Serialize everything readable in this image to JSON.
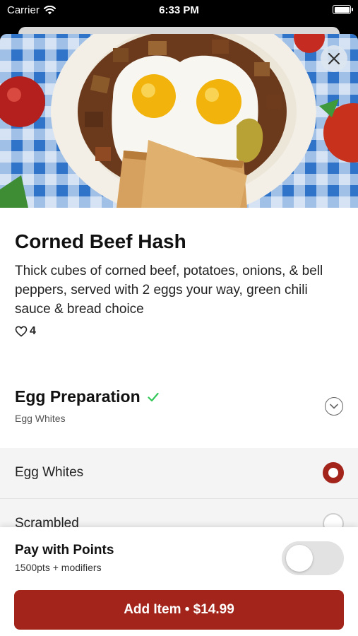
{
  "status_bar": {
    "carrier": "Carrier",
    "time": "6:33 PM",
    "icons": [
      "wifi-icon",
      "battery-icon"
    ]
  },
  "hero": {
    "icons": [
      "close-icon"
    ]
  },
  "item": {
    "title": "Corned Beef Hash",
    "description": "Thick cubes of corned beef, potatoes, onions, & bell peppers, served with 2 eggs your way, green chili sauce & bread choice",
    "likes": "4",
    "like_icon": "heart-outline-icon"
  },
  "section": {
    "title": "Egg Preparation",
    "selected_summary": "Egg Whites",
    "check_icon": "checkmark-icon",
    "toggle_icon": "chevron-down-circle-icon",
    "check_color": "#34c759"
  },
  "options": [
    {
      "label": "Egg Whites",
      "selected": true
    },
    {
      "label": "Scrambled",
      "selected": false
    }
  ],
  "footer": {
    "pay_title": "Pay with Points",
    "pay_sub": "1500pts + modifiers",
    "toggle_on": false,
    "add_button": "Add Item • $14.99"
  },
  "colors": {
    "accent": "#a3241b",
    "tablecloth": "#2f74c9"
  }
}
